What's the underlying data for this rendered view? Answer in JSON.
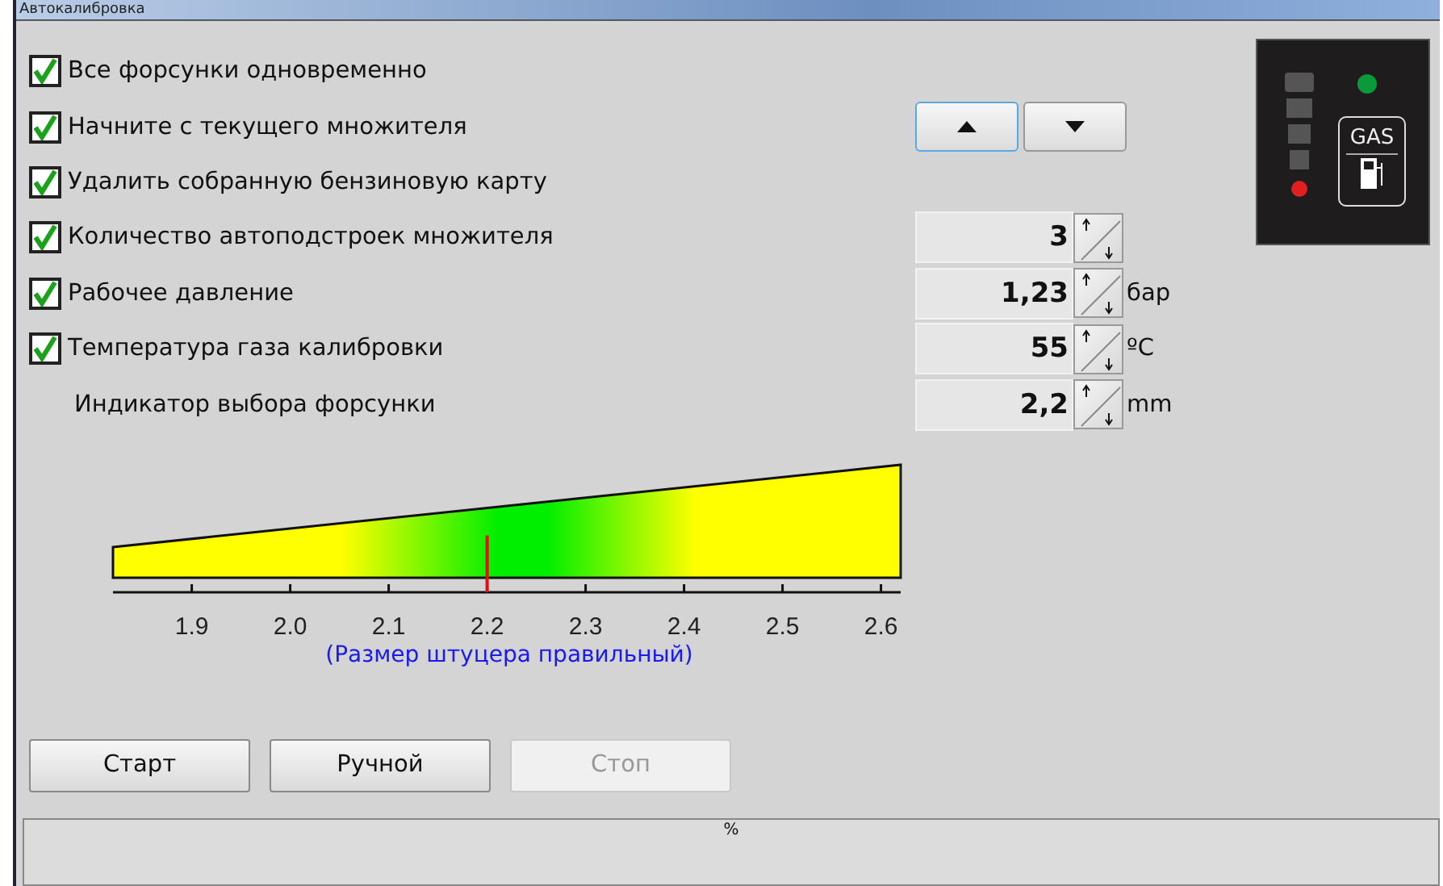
{
  "window": {
    "title": "Автокалибровка"
  },
  "options": [
    {
      "kind": "checkbox",
      "label": "Все форсунки одновременно",
      "checked": true
    },
    {
      "kind": "checkbox",
      "label": "Начните с текущего множителя",
      "checked": true,
      "control": {
        "kind": "arrows"
      }
    },
    {
      "kind": "checkbox",
      "label": "Удалить собранную бензиновую карту",
      "checked": true
    },
    {
      "kind": "checkbox",
      "label": "Количество автоподстроек множителя",
      "checked": true,
      "control": {
        "kind": "spinner",
        "value": "3"
      }
    },
    {
      "kind": "checkbox",
      "label": "Рабочее давление",
      "checked": true,
      "control": {
        "kind": "spinner",
        "value": "1,23",
        "unit": "бар"
      }
    },
    {
      "kind": "checkbox",
      "label": "Температура газа калибровки",
      "checked": true,
      "control": {
        "kind": "spinner",
        "value": "55",
        "unit": "ºC"
      }
    },
    {
      "kind": "plain",
      "label": "Индикатор выбора форсунки",
      "control": {
        "kind": "spinner",
        "value": "2,2",
        "unit": "mm"
      }
    }
  ],
  "indicator": {
    "label": "GAS"
  },
  "gauge": {
    "ticks": [
      "1.9",
      "2.0",
      "2.1",
      "2.2",
      "2.3",
      "2.4",
      "2.5",
      "2.6"
    ],
    "level": 0.475,
    "caption": "(Размер штуцера правильный)"
  },
  "buttons": [
    {
      "label": "Старт",
      "disabled": false
    },
    {
      "label": "Ручной",
      "disabled": false
    },
    {
      "label": "Стоп",
      "disabled": true
    }
  ],
  "status_bar": {
    "text": "%",
    "level": 0
  }
}
